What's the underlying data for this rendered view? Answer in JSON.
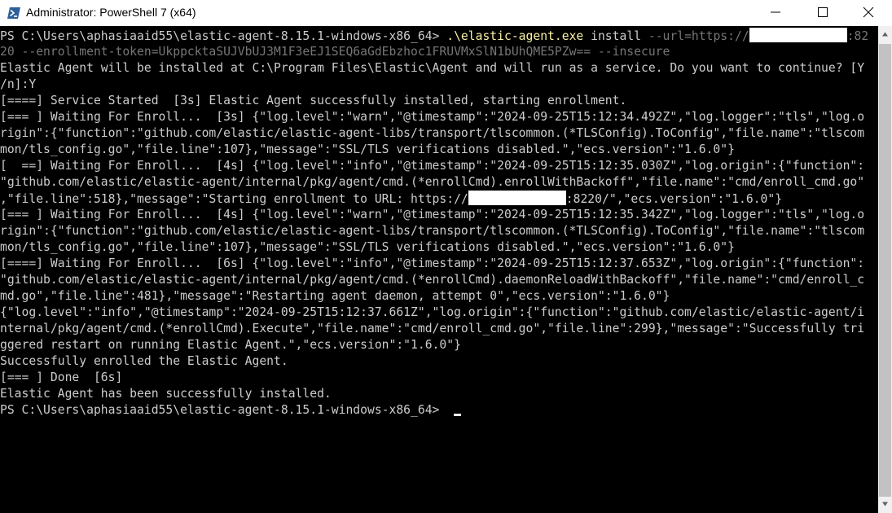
{
  "window": {
    "title": "Administrator: PowerShell 7 (x64)",
    "icon": "powershell-icon",
    "controls": [
      "minimize-icon",
      "maximize-icon",
      "close-icon"
    ]
  },
  "console": {
    "prompt": "PS C:\\Users\\aphasiaaid55\\elastic-agent-8.15.1-windows-x86_64> ",
    "command": {
      "executable": ".\\elastic-agent.exe",
      "subcommand": " install ",
      "url_param": "--url=https://",
      "url_suffix": ":82",
      "line2": "20 --enrollment-token=UkppcktaSUJVbUJ3M1F3eEJ1SEQ6aGdEbzhoc1FRUVMxSlN1bUhQME5PZw== --insecure"
    },
    "output": [
      "Elastic Agent will be installed at C:\\Program Files\\Elastic\\Agent and will run as a service. Do you want to continue? [Y",
      "/n]:Y",
      "[====] Service Started  [3s] Elastic Agent successfully installed, starting enrollment.",
      "[=== ] Waiting For Enroll...  [3s] {\"log.level\":\"warn\",\"@timestamp\":\"2024-09-25T15:12:34.492Z\",\"log.logger\":\"tls\",\"log.o",
      "rigin\":{\"function\":\"github.com/elastic/elastic-agent-libs/transport/tlscommon.(*TLSConfig).ToConfig\",\"file.name\":\"tlscom",
      "mon/tls_config.go\",\"file.line\":107},\"message\":\"SSL/TLS verifications disabled.\",\"ecs.version\":\"1.6.0\"}",
      "[  ==] Waiting For Enroll...  [4s] {\"log.level\":\"info\",\"@timestamp\":\"2024-09-25T15:12:35.030Z\",\"log.origin\":{\"function\":",
      "\"github.com/elastic/elastic-agent/internal/pkg/agent/cmd.(*enrollCmd).enrollWithBackoff\",\"file.name\":\"cmd/enroll_cmd.go\""
    ],
    "url_line": {
      "before": ",\"file.line\":518},\"message\":\"Starting enrollment to URL: https://",
      "after": ":8220/\",\"ecs.version\":\"1.6.0\"}"
    },
    "output2": [
      "[=== ] Waiting For Enroll...  [4s] {\"log.level\":\"warn\",\"@timestamp\":\"2024-09-25T15:12:35.342Z\",\"log.logger\":\"tls\",\"log.o",
      "rigin\":{\"function\":\"github.com/elastic/elastic-agent-libs/transport/tlscommon.(*TLSConfig).ToConfig\",\"file.name\":\"tlscom",
      "mon/tls_config.go\",\"file.line\":107},\"message\":\"SSL/TLS verifications disabled.\",\"ecs.version\":\"1.6.0\"}",
      "[====] Waiting For Enroll...  [6s] {\"log.level\":\"info\",\"@timestamp\":\"2024-09-25T15:12:37.653Z\",\"log.origin\":{\"function\":",
      "\"github.com/elastic/elastic-agent/internal/pkg/agent/cmd.(*enrollCmd).daemonReloadWithBackoff\",\"file.name\":\"cmd/enroll_c",
      "md.go\",\"file.line\":481},\"message\":\"Restarting agent daemon, attempt 0\",\"ecs.version\":\"1.6.0\"}",
      "{\"log.level\":\"info\",\"@timestamp\":\"2024-09-25T15:12:37.661Z\",\"log.origin\":{\"function\":\"github.com/elastic/elastic-agent/i",
      "nternal/pkg/agent/cmd.(*enrollCmd).Execute\",\"file.name\":\"cmd/enroll_cmd.go\",\"file.line\":299},\"message\":\"Successfully tri",
      "ggered restart on running Elastic Agent.\",\"ecs.version\":\"1.6.0\"}",
      "Successfully enrolled the Elastic Agent.",
      "[=== ] Done  [6s]",
      "Elastic Agent has been successfully installed."
    ],
    "final_prompt": "PS C:\\Users\\aphasiaaid55\\elastic-agent-8.15.1-windows-x86_64> "
  },
  "colors": {
    "background": "#000000",
    "text": "#cccccc",
    "command": "#f9f1a5",
    "parameter": "#767676"
  }
}
